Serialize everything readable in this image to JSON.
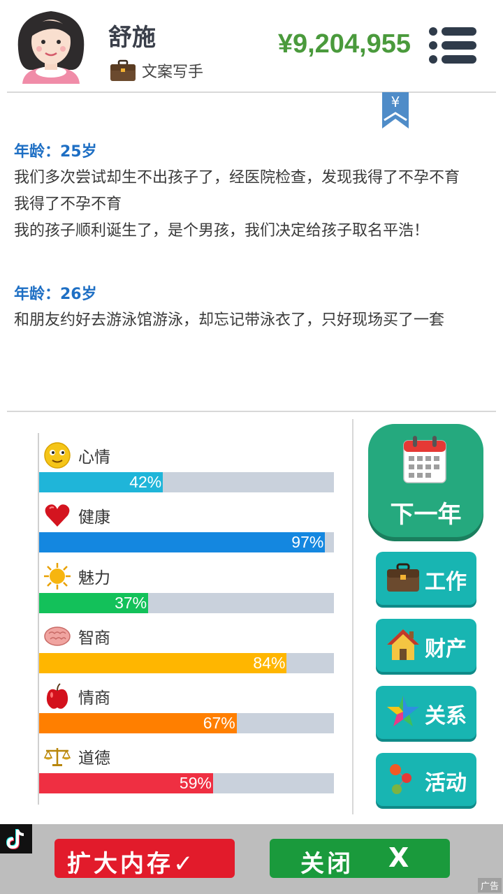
{
  "header": {
    "name": "舒施",
    "job": "文案写手",
    "money": "¥9,204,955",
    "bookmark_symbol": "¥"
  },
  "log": [
    {
      "age": "年龄：25岁",
      "lines": [
        "我们多次尝试却生不出孩子了，经医院检查，发现我得了不孕不育",
        "我得了不孕不育",
        "我的孩子顺利诞生了，是个男孩，我们决定给孩子取名平浩！"
      ]
    },
    {
      "age": "年龄：26岁",
      "lines": [
        "和朋友约好去游泳馆游泳，却忘记带泳衣了，只好现场买了一套"
      ]
    }
  ],
  "stats": [
    {
      "label": "心情",
      "percent": 42,
      "text": "42%",
      "color": "#1fb5d9",
      "icon": "smiley-icon"
    },
    {
      "label": "健康",
      "percent": 97,
      "text": "97%",
      "color": "#1487e0",
      "icon": "heart-icon"
    },
    {
      "label": "魅力",
      "percent": 37,
      "text": "37%",
      "color": "#13c15a",
      "icon": "sun-icon"
    },
    {
      "label": "智商",
      "percent": 84,
      "text": "84%",
      "color": "#ffb600",
      "icon": "brain-icon"
    },
    {
      "label": "情商",
      "percent": 67,
      "text": "67%",
      "color": "#ff7f00",
      "icon": "apple-icon"
    },
    {
      "label": "道德",
      "percent": 59,
      "text": "59%",
      "color": "#ef2f42",
      "icon": "scale-icon"
    }
  ],
  "actions": {
    "next_year": "下一年",
    "work": "工作",
    "assets": "财产",
    "relations": "关系",
    "activities": "活动"
  },
  "ad": {
    "expand_label": "扩大内存✓",
    "close_label": "关闭",
    "close_mark": "X",
    "ad_tag": "广告"
  }
}
